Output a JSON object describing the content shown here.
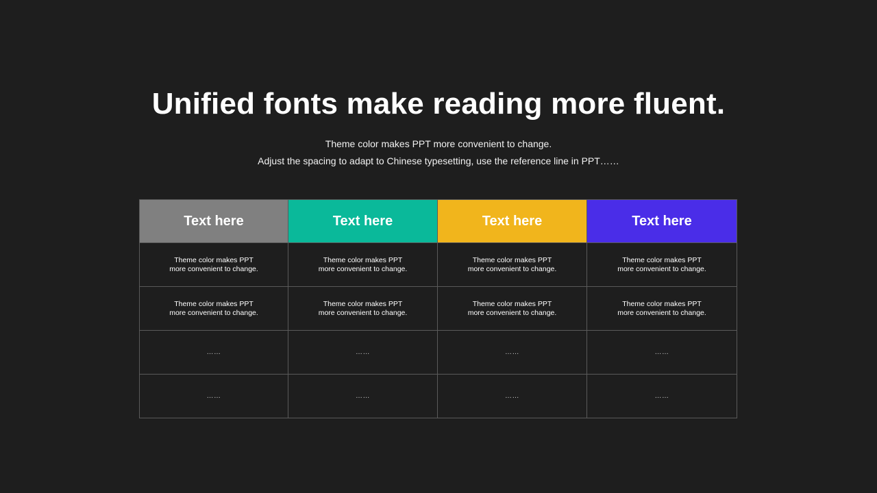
{
  "slide": {
    "title": "Unified fonts make reading more fluent.",
    "subtitle_line1": "Theme color makes PPT more convenient to change.",
    "subtitle_line2": "Adjust the spacing to adapt to Chinese typesetting, use the reference line in PPT……"
  },
  "table": {
    "headers": [
      {
        "label": "Text here",
        "color": "#808080"
      },
      {
        "label": "Text here",
        "color": "#0ab99a"
      },
      {
        "label": "Text here",
        "color": "#f1b51c"
      },
      {
        "label": "Text here",
        "color": "#4a2de8"
      }
    ],
    "rows": [
      [
        "Theme color makes PPT\nmore convenient to change.",
        "Theme color makes PPT\nmore convenient to change.",
        "Theme color makes PPT\nmore convenient to change.",
        "Theme color makes PPT\nmore convenient to change."
      ],
      [
        "Theme color makes PPT\nmore convenient to change.",
        "Theme color makes PPT\nmore convenient to change.",
        "Theme color makes PPT\nmore convenient to change.",
        "Theme color makes PPT\nmore convenient to change."
      ],
      [
        "……",
        "……",
        "……",
        "……"
      ],
      [
        "……",
        "……",
        "……",
        "……"
      ]
    ]
  },
  "colors": {
    "background": "#1e1e1e",
    "grid_line": "#5a5a5a"
  }
}
